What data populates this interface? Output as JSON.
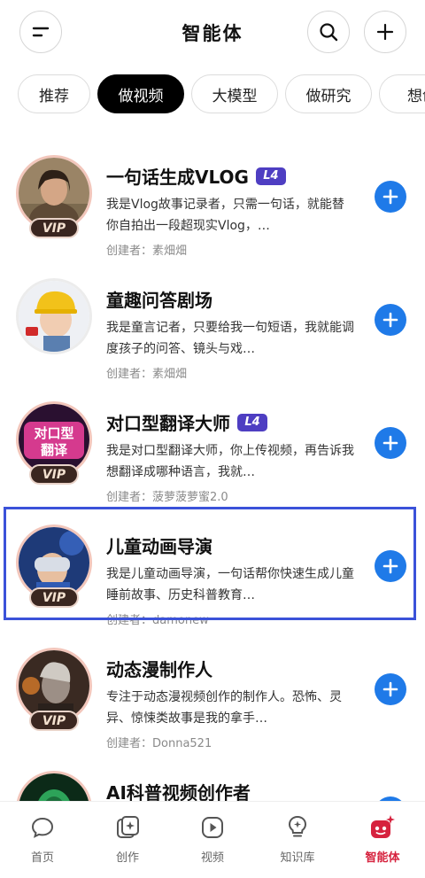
{
  "header": {
    "title": "智能体",
    "menu_icon": "menu-minus-icon",
    "search_icon": "search-icon",
    "add_icon": "plus-icon"
  },
  "tabs": [
    {
      "label": "推荐",
      "active": false
    },
    {
      "label": "做视频",
      "active": true
    },
    {
      "label": "大模型",
      "active": false
    },
    {
      "label": "做研究",
      "active": false
    },
    {
      "label": "想创",
      "active": false
    }
  ],
  "agents": [
    {
      "title": "一句话生成VLOG",
      "badge": "L4",
      "vip": "VIP",
      "description": "我是Vlog故事记录者，只需一句话，就能替你自拍出一段超现实Vlog，…",
      "creator": "创建者：素畑畑"
    },
    {
      "title": "童趣问答剧场",
      "badge": "",
      "vip": "",
      "description": "我是童言记者，只要给我一句短语，我就能调度孩子的问答、镜头与戏…",
      "creator": "创建者：素畑畑"
    },
    {
      "title": "对口型翻译大师",
      "badge": "L4",
      "vip": "VIP",
      "description": "我是对口型翻译大师，你上传视频，再告诉我想翻译成哪种语言，我就…",
      "creator": "创建者：菠萝菠萝蜜2.0"
    },
    {
      "title": "儿童动画导演",
      "badge": "",
      "vip": "VIP",
      "description": "我是儿童动画导演，一句话帮你快速生成儿童睡前故事、历史科普教育…",
      "creator": "创建者：damonew"
    },
    {
      "title": "动态漫制作人",
      "badge": "",
      "vip": "VIP",
      "description": "专注于动态漫视频创作的制作人。恐怖、灵异、惊悚类故事是我的拿手…",
      "creator": "创建者：Donna521"
    },
    {
      "title": "AI科普视频创作者",
      "badge": "",
      "vip": "",
      "description": "",
      "creator": ""
    }
  ],
  "avatar_art": {
    "avatar_0": "对口型",
    "avatar_1": "翻译"
  },
  "bottom_nav": [
    {
      "label": "首页",
      "icon": "chat-bubble-icon",
      "active": false
    },
    {
      "label": "创作",
      "icon": "sparkle-cards-icon",
      "active": false
    },
    {
      "label": "视频",
      "icon": "play-icon",
      "active": false
    },
    {
      "label": "知识库",
      "icon": "lightbulb-icon",
      "active": false
    },
    {
      "label": "智能体",
      "icon": "agent-robot-icon",
      "active": true
    }
  ],
  "colors": {
    "accent_blue": "#1f7ae8",
    "active_nav": "#d6223e",
    "badge": "#4e3ec2",
    "highlight": "#3b52d9"
  }
}
